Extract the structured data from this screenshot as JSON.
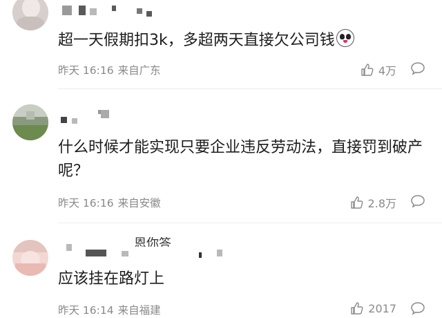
{
  "comments": [
    {
      "text": "超一天假期扣3k，多超两天直接欠公司钱",
      "time": "昨天 16:16",
      "location": "来自广东",
      "likes": "4万",
      "emoji": "panda-emoji"
    },
    {
      "text": "什么时候才能实现只要企业违反劳动法，直接罚到破产呢？",
      "time": "昨天 16:16",
      "location": "来自安徽",
      "likes": "2.8万"
    },
    {
      "text": "应该挂在路灯上",
      "time": "昨天 16:14",
      "location": "来自福建",
      "likes": "2017",
      "username_visible": "恩你答"
    }
  ],
  "icons": {
    "like": "thumbs-up-icon",
    "reply": "comment-bubble-icon"
  },
  "colors": {
    "text": "#1c1c1c",
    "meta": "#8a8a8a",
    "background": "#ffffff"
  }
}
